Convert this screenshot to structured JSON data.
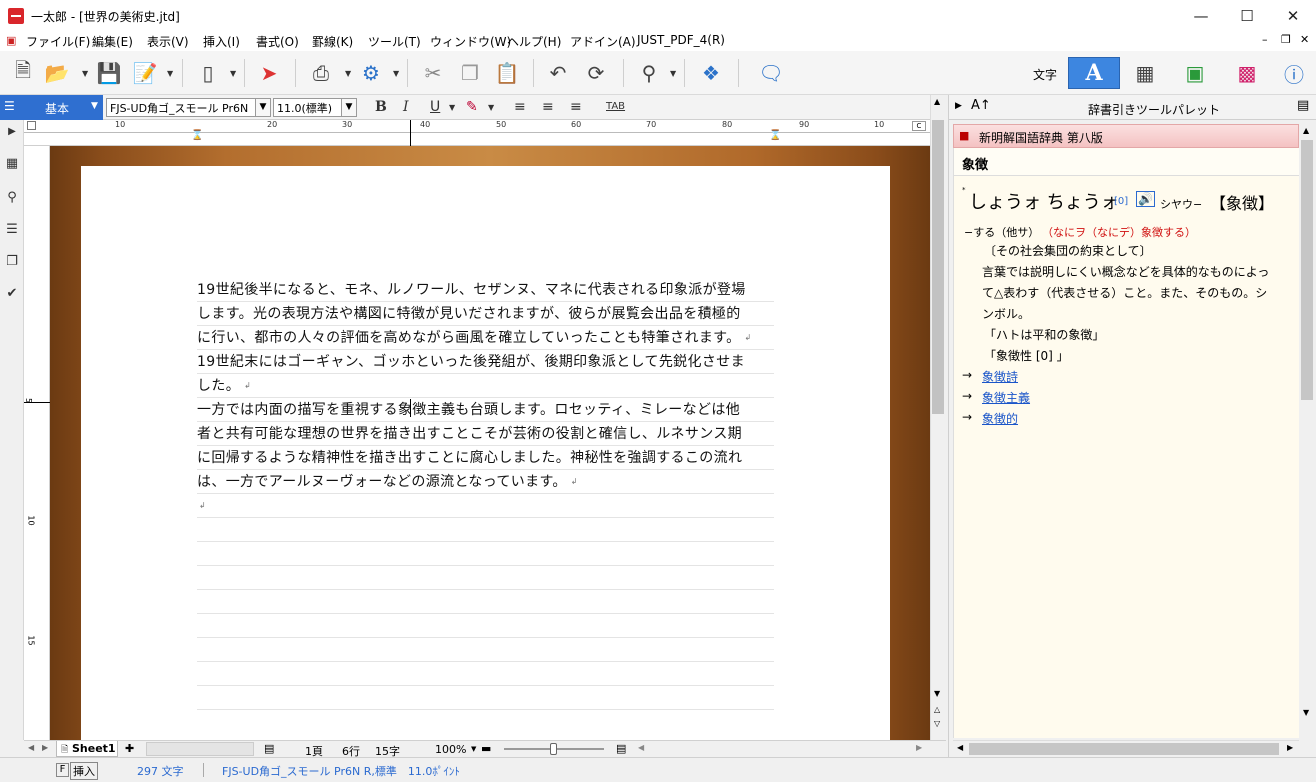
{
  "window": {
    "title": "一太郎 - [世界の美術史.jtd]"
  },
  "menu": [
    "ファイル(F)",
    "編集(E)",
    "表示(V)",
    "挿入(I)",
    "書式(O)",
    "罫線(K)",
    "ツール(T)",
    "ウィンドウ(W)",
    "ヘルプ(H)",
    "アドイン(A)",
    "JUST_PDF_4(R)"
  ],
  "toolbar": {
    "mode_label": "文字"
  },
  "format": {
    "style": "基本",
    "font": "FJS-UD角ゴ_スモール Pr6N",
    "size": "11.0(標準)",
    "tab": "TAB"
  },
  "ruler": {
    "h": [
      "10",
      "10",
      "20",
      "30",
      "40",
      "50",
      "60",
      "70",
      "80",
      "90"
    ],
    "right": "C",
    "v": [
      "5",
      "10",
      "15"
    ]
  },
  "document": {
    "lines": [
      "19世紀後半になると、モネ、ルノワール、セザンヌ、マネに代表される印象派が登場",
      "します。光の表現方法や構図に特徴が見いだされますが、彼らが展覧会出品を積極的",
      "に行い、都市の人々の評価を高めながら画風を確立していったことも特筆されます。",
      "19世紀末にはゴーギャン、ゴッホといった後発組が、後期印象派として先鋭化させま",
      "した。",
      "一方では内面の描写を重視する象徴主義も台頭します。ロセッティ、ミレーなどは他",
      "者と共有可能な理想の世界を描き出すことこそが芸術の役割と確信し、ルネサンス期",
      "に回帰するような精神性を描き出すことに腐心しました。神秘性を強調するこの流れ",
      "は、一方でアールヌーヴォーなどの源流となっています。"
    ]
  },
  "sheet": {
    "tab": "Sheet1",
    "add": "✚"
  },
  "bottom": {
    "page": "1頁",
    "line": "6行",
    "col": "15字",
    "zoom": "100%"
  },
  "status": {
    "key": "F",
    "mode": "挿入",
    "count": "297 文字",
    "font": "FJS-UD角ゴ_スモール Pr6N R,標準　11.0ﾎﾟｲﾝﾄ"
  },
  "panel": {
    "title": "辞書引きツールパレット",
    "dict": "新明解国語辞典 第八版",
    "word": "象徴",
    "reading": "しょうォ ちょうォ",
    "ref": "[0]",
    "kana": "シヤウ−",
    "kanji": "【象徴】",
    "pos": "−する（他サ）",
    "pos_red": "（なにヲ（なにデ）象徴する）",
    "def1": "〔その社会集団の約束として〕",
    "def2": "言葉では説明しにくい概念などを具体的なものによっ",
    "def3": "て△表わす（代表させる）こと。また、そのもの。シ",
    "def4": "ンボル。",
    "ex1": "「ハトは平和の象徴」",
    "ex2": "「象徴性 [0] 」",
    "links": [
      "象徴詩",
      "象徴主義",
      "象徴的"
    ]
  }
}
